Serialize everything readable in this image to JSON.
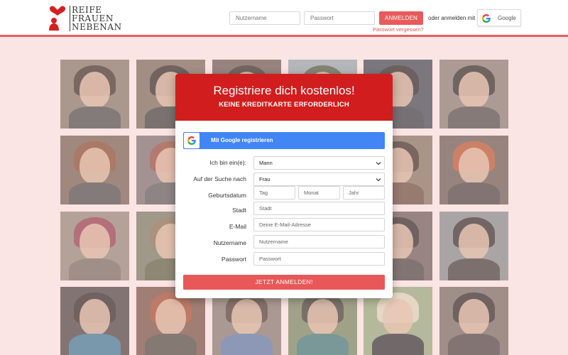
{
  "brand": {
    "logo_lines": [
      "REIFE",
      "FRAUEN",
      "NEBENAN"
    ],
    "accent": "#e06060"
  },
  "header_login": {
    "username_placeholder": "Nutzername",
    "password_placeholder": "Passwort",
    "login_label": "ANMELDEN",
    "or_text": "oder anmelden mit",
    "google_label": "Google",
    "forgot_label": "Passwort vergessen?"
  },
  "photo_grid": {
    "tiles": [
      {
        "name": "photo-1-1",
        "bg": "#7a6a58",
        "hair": "#2a1c14",
        "body": "#3a3a3a"
      },
      {
        "name": "photo-1-2",
        "bg": "#6e5a4a",
        "hair": "#1e1510",
        "body": "#2c2c2c"
      },
      {
        "name": "photo-1-3",
        "bg": "#5a4a40",
        "hair": "#221810",
        "body": "#404040"
      },
      {
        "name": "photo-1-4",
        "bg": "#8a9aa0",
        "hair": "#3a4a30",
        "body": "#5a6a50"
      },
      {
        "name": "photo-1-5",
        "bg": "#2f3540",
        "hair": "#15120f",
        "body": "#262a30"
      },
      {
        "name": "photo-1-6",
        "bg": "#7c7066",
        "hair": "#1c1612",
        "body": "#3e3a36"
      },
      {
        "name": "photo-2-1",
        "bg": "#6a5040",
        "hair": "#7a3a1a",
        "body": "#3c3a3a"
      },
      {
        "name": "photo-2-2",
        "bg": "#706060",
        "hair": "#8a3a28",
        "body": "#4a4a4a"
      },
      {
        "name": "photo-2-5",
        "bg": "#7a6450",
        "hair": "#2a1a10",
        "body": "#5a3a2a"
      },
      {
        "name": "photo-2-6",
        "bg": "#5a4a40",
        "hair": "#b0461c",
        "body": "#3a3030"
      },
      {
        "name": "photo-3-1",
        "bg": "#8a7a6a",
        "hair": "#8a2a3a",
        "body": "#6a5a50"
      },
      {
        "name": "photo-3-2",
        "bg": "#6a6a50",
        "hair": "#7a6040",
        "body": "#4a5030"
      },
      {
        "name": "photo-3-5",
        "bg": "#5a4a48",
        "hair": "#1a1410",
        "body": "#3a3030"
      },
      {
        "name": "photo-3-6",
        "bg": "#7a8080",
        "hair": "#1e1a16",
        "body": "#2e2a26"
      },
      {
        "name": "photo-4-1",
        "bg": "#3a3030",
        "hair": "#1a1410",
        "body": "#2a6a8a"
      },
      {
        "name": "photo-4-2",
        "bg": "#6a4030",
        "hair": "#9a3a1c",
        "body": "#3e3830"
      },
      {
        "name": "photo-4-3",
        "bg": "#7a6a60",
        "hair": "#3a2a20",
        "body": "#4a6a9a"
      },
      {
        "name": "photo-4-4",
        "bg": "#6a7a50",
        "hair": "#2a2a20",
        "body": "#2e6a6a"
      },
      {
        "name": "photo-4-5",
        "bg": "#8aa070",
        "hair": "#d8d0b0",
        "body": "#1e1e1e"
      },
      {
        "name": "photo-4-6",
        "bg": "#6a5a50",
        "hair": "#1a1410",
        "body": "#3a3030"
      }
    ]
  },
  "register": {
    "title": "Registriere dich kostenlos!",
    "subtitle": "KEINE KREDITKARTE ERFORDERLICH",
    "google_button": "Mit Google registrieren",
    "labels": {
      "i_am": "Ich bin ein(e):",
      "looking_for": "Auf der Suche nach",
      "birthdate": "Geburtsdatum",
      "city": "Stadt",
      "email": "E-Mail",
      "username": "Nutzername",
      "password": "Passwort"
    },
    "values": {
      "i_am": "Mann",
      "looking_for": "Frau"
    },
    "placeholders": {
      "day": "Tag",
      "month": "Monat",
      "year": "Jahr",
      "city": "Stadt",
      "email": "Deine E-Mail-Adresse",
      "username": "Nutzername",
      "password": "Passwort"
    },
    "submit": "JETZT ANMELDEN!",
    "header_color": "#d11d1d",
    "google_color": "#4285f4",
    "submit_color": "#e95858"
  }
}
